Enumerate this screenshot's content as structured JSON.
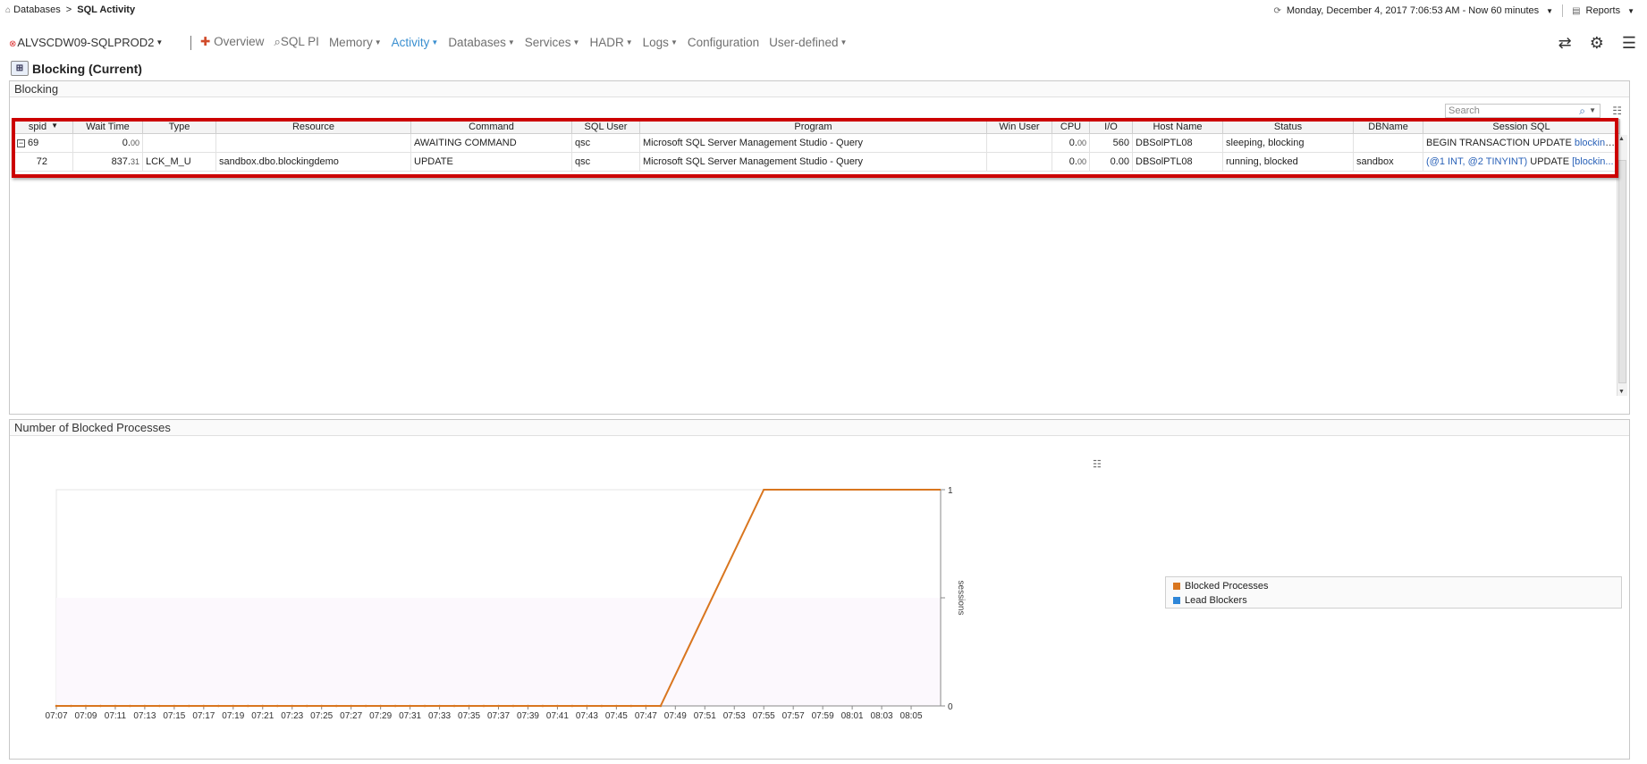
{
  "breadcrumb": {
    "root": "Databases",
    "separator": ">",
    "current": "SQL Activity"
  },
  "topbar": {
    "datetime": "Monday, December 4, 2017 7:06:53 AM - Now 60 minutes",
    "reports": "Reports"
  },
  "server": "ALVSCDW09-SQLPROD2",
  "nav": {
    "overview": "Overview",
    "sqlpi": "SQL PI",
    "memory": "Memory",
    "activity": "Activity",
    "databases": "Databases",
    "services": "Services",
    "hadr": "HADR",
    "logs": "Logs",
    "configuration": "Configuration",
    "userdefined": "User-defined",
    "icons": [
      "refresh-icon",
      "gear-icon",
      "hamburger-menu-icon"
    ]
  },
  "page_title": "Blocking (Current)",
  "blocking_panel": {
    "title": "Blocking",
    "search_placeholder": "Search",
    "columns": [
      "spid",
      "Wait Time",
      "Type",
      "Resource",
      "Command",
      "SQL User",
      "Program",
      "Win User",
      "CPU",
      "I/O",
      "Host Name",
      "Status",
      "DBName",
      "Session SQL"
    ],
    "rows": [
      {
        "spid": "69",
        "wait_int": "0.",
        "wait_dec": "00",
        "type": "",
        "resource": "",
        "command": "AWAITING COMMAND",
        "sql_user": "qsc",
        "program": "Microsoft SQL Server Management Studio - Query",
        "win_user": "",
        "cpu_int": "0.",
        "cpu_dec": "00",
        "io": "560",
        "host": "DBSolPTL08",
        "status": "sleeping, blocking",
        "dbname": "",
        "sql_plain": "BEGIN TRANSACTION UPDATE ",
        "sql_link": "blocking..."
      },
      {
        "spid": "72",
        "wait_int": "837.",
        "wait_dec": "31",
        "type": "LCK_M_U",
        "resource": "sandbox.dbo.blockingdemo",
        "command": "UPDATE",
        "sql_user": "qsc",
        "program": "Microsoft SQL Server Management Studio - Query",
        "win_user": "",
        "cpu_int": "0.",
        "cpu_dec": "00",
        "io": "0.00",
        "host": "DBSolPTL08",
        "status": "running, blocked",
        "dbname": "sandbox",
        "sql_link1": "(@1 INT, @2 TINYINT)",
        "sql_plain": " UPDATE ",
        "sql_link2": "[blockin..."
      }
    ]
  },
  "chart_panel": {
    "title": "Number of Blocked Processes"
  },
  "chart_data": {
    "type": "line",
    "title": "",
    "xlabel": "",
    "ylabel": "sessions",
    "ylim": [
      0,
      1
    ],
    "yticks": [
      "0",
      "1"
    ],
    "x": [
      "07:07",
      "07:09",
      "07:11",
      "07:13",
      "07:15",
      "07:17",
      "07:19",
      "07:21",
      "07:23",
      "07:25",
      "07:27",
      "07:29",
      "07:31",
      "07:33",
      "07:35",
      "07:37",
      "07:39",
      "07:41",
      "07:43",
      "07:45",
      "07:47",
      "07:49",
      "07:51",
      "07:53",
      "07:55",
      "07:57",
      "07:59",
      "08:01",
      "08:03",
      "08:05"
    ],
    "series": [
      {
        "name": "Blocked Processes",
        "color": "#d9761f",
        "x": [
          "07:07",
          "07:48",
          "07:55",
          "08:07"
        ],
        "values": [
          0,
          0,
          1,
          1
        ]
      },
      {
        "name": "Lead Blockers",
        "color": "#2e86d8",
        "x": [],
        "values": []
      }
    ],
    "legend": "right",
    "grid": false
  }
}
